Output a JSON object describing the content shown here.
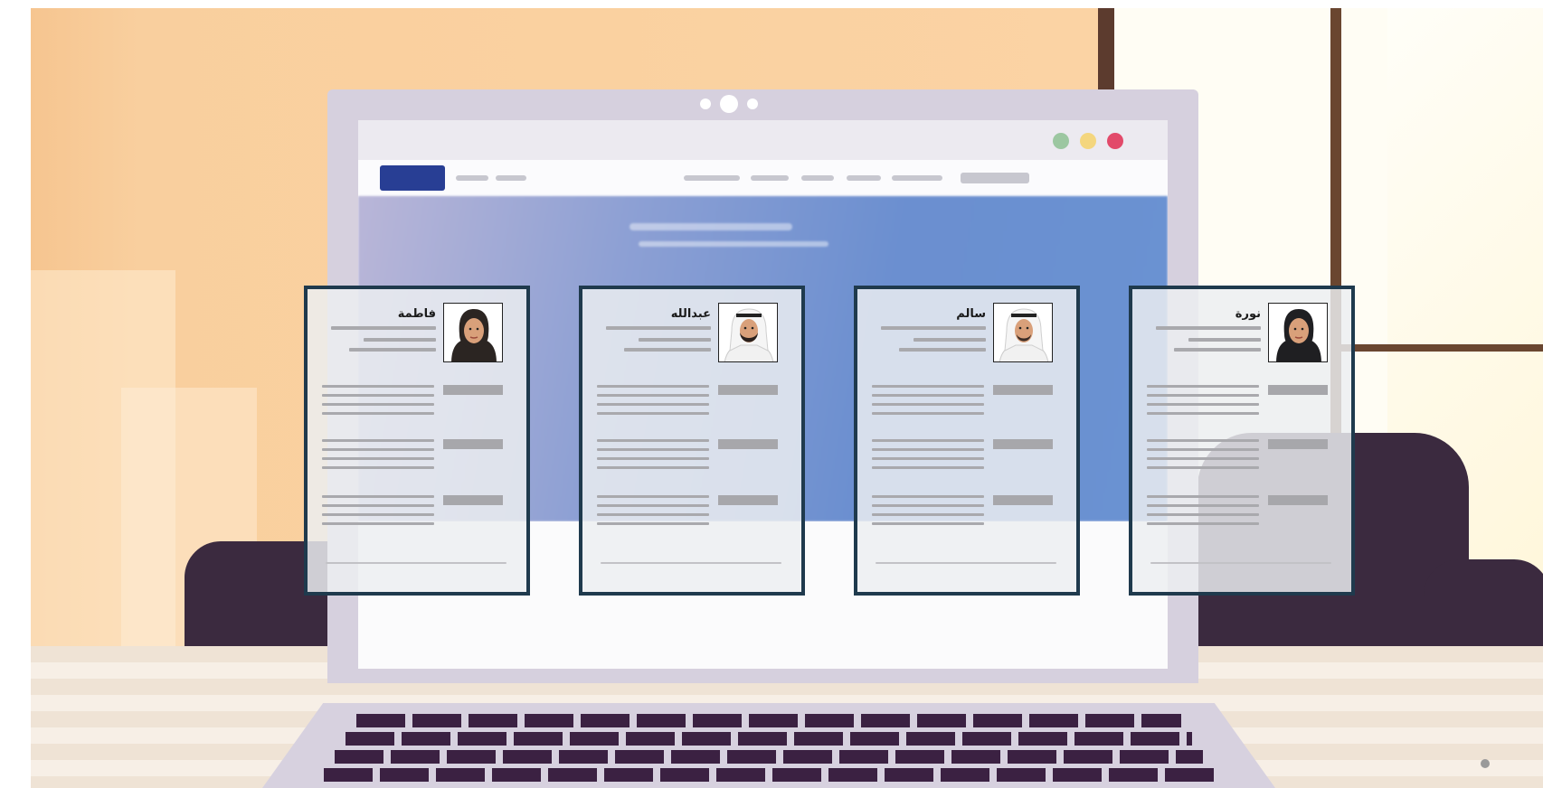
{
  "profiles": [
    {
      "name": "فاطمة",
      "avatar": "woman-avatar-icon"
    },
    {
      "name": "عبدالله",
      "avatar": "man-ghutra-avatar-icon"
    },
    {
      "name": "سالم",
      "avatar": "man-ghutra-avatar-icon"
    },
    {
      "name": "نورة",
      "avatar": "woman-avatar-icon"
    }
  ],
  "window_controls": {
    "colors": [
      "#e24a6a",
      "#f4d67e",
      "#9cc7a1"
    ]
  },
  "colors": {
    "card_border": "#1f3a4d",
    "nav_button": "#283e94",
    "wall": "#fad1a0"
  }
}
